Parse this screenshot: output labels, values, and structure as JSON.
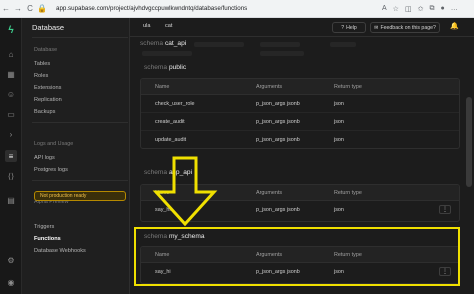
{
  "browser": {
    "url": "app.supabase.com/project/ajvhdvgccpuwlkwndntq/database/functions",
    "back": "←",
    "forward": "→",
    "reload": "C"
  },
  "rail": {
    "icons": [
      "supabase-logo-icon",
      "home-icon",
      "table-editor-icon",
      "auth-icon",
      "storage-icon",
      "sql-editor-icon",
      "reports-icon",
      "database-icon",
      "api-icon",
      "settings-icon",
      "user-icon"
    ]
  },
  "sidebar": {
    "title": "Database",
    "groups": {
      "database": "Database",
      "logs": "Logs and Usage",
      "alpha": "Alpha Preview"
    },
    "items": {
      "tables": "Tables",
      "roles": "Roles",
      "extensions": "Extensions",
      "replication": "Replication",
      "backups": "Backups",
      "api_logs": "API logs",
      "postgres_logs": "Postgres logs",
      "triggers": "Triggers",
      "functions": "Functions",
      "webhooks": "Database Webhooks"
    },
    "badge": "Not production ready"
  },
  "topbar": {
    "crumb1": "ula",
    "crumb2": "cat",
    "help": "Help",
    "feedback": "Feedback on this page?"
  },
  "schemas": {
    "keyword": "schema",
    "cat_api": "cat_api",
    "public": "public",
    "asp_api": "asp_api",
    "my_schema": "my_schema"
  },
  "table_headers": {
    "name": "Name",
    "arguments": "Arguments",
    "return_type": "Return type"
  },
  "public_rows": [
    {
      "name": "check_user_role",
      "args": "p_json_args jsonb",
      "ret": "json"
    },
    {
      "name": "create_audit",
      "args": "p_json_args jsonb",
      "ret": "json"
    },
    {
      "name": "update_audit",
      "args": "p_json_args jsonb",
      "ret": "json"
    }
  ],
  "asp_rows": [
    {
      "name": "say_hi",
      "args": "p_json_args jsonb",
      "ret": "json"
    }
  ],
  "my_schema_rows": [
    {
      "name": "say_hi",
      "args": "p_json_args jsonb",
      "ret": "json"
    }
  ],
  "more_label": "⋮",
  "colors": {
    "highlight": "#f0e000",
    "brand": "#3ecf8e",
    "warning": "#f0c14b"
  }
}
